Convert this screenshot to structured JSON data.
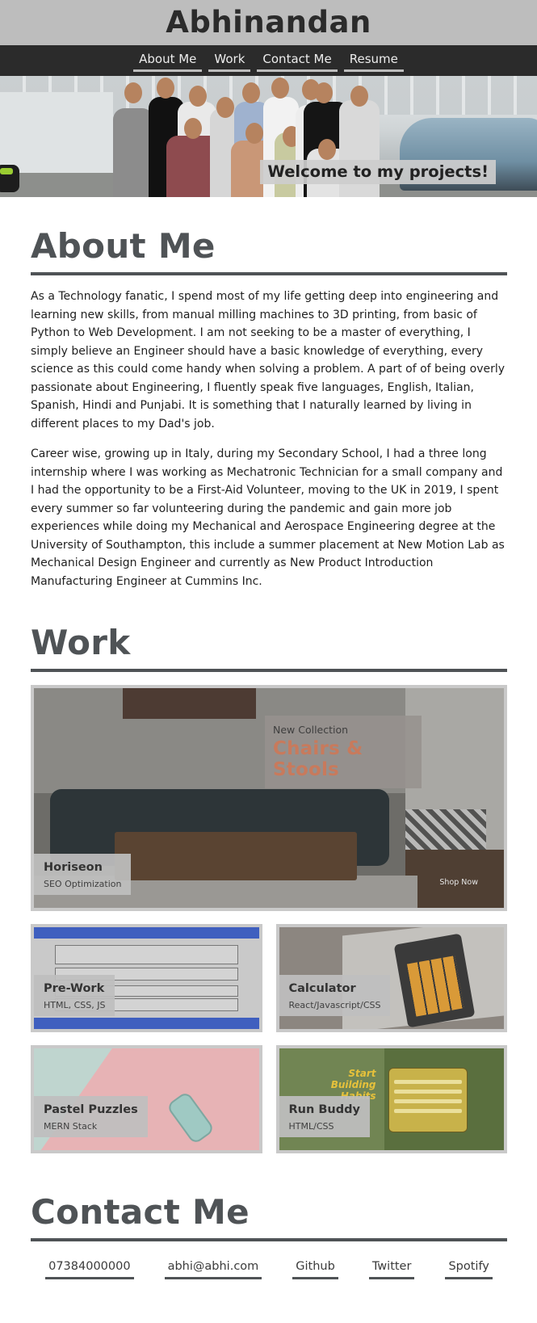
{
  "site": {
    "title": "Abhinandan"
  },
  "nav": {
    "items": [
      {
        "label": "About Me"
      },
      {
        "label": "Work"
      },
      {
        "label": "Contact Me"
      },
      {
        "label": "Resume"
      }
    ]
  },
  "hero": {
    "welcome": "Welcome to my projects!"
  },
  "about": {
    "heading": "About Me",
    "paragraphs": [
      "As a Technology fanatic, I spend most of my life getting deep into engineering and learning new skills, from manual milling machines to 3D printing, from basic of Python to Web Development. I am not seeking to be a master of everything, I simply believe an Engineer should have a basic knowledge of everything, every science as this could come handy when solving a problem. A part of of being overly passionate about Engineering, I fluently speak five languages, English, Italian, Spanish, Hindi and Punjabi. It is something that I naturally learned by living in different places to my Dad's job.",
      "Career wise, growing up in Italy, during my Secondary School, I had a three long internship where I was working as Mechatronic Technician for a small company and I had the opportunity to be a First-Aid Volunteer, moving to the UK in 2019, I spent every summer so far volunteering during the pandemic and gain more job experiences while doing my Mechanical and Aerospace Engineering degree at the University of Southampton, this include a summer placement at New Motion Lab as Mechanical Design Engineer and currently as New Product Introduction Manufacturing Engineer at Cummins Inc."
    ]
  },
  "work": {
    "heading": "Work",
    "projects": [
      {
        "title": "Horiseon",
        "subtitle": "SEO Optimization",
        "preview": {
          "collection": "New Collection",
          "headline": "Chairs & Stools",
          "cta": "Shop Now"
        }
      },
      {
        "title": "Pre-Work",
        "subtitle": "HTML, CSS, JS"
      },
      {
        "title": "Calculator",
        "subtitle": "React/Javascript/CSS"
      },
      {
        "title": "Pastel Puzzles",
        "subtitle": "MERN Stack"
      },
      {
        "title": "Run Buddy",
        "subtitle": "HTML/CSS",
        "preview": {
          "headline": "Start Building Habits"
        }
      }
    ]
  },
  "contact": {
    "heading": "Contact Me",
    "links": [
      {
        "label": "07384000000"
      },
      {
        "label": "abhi@abhi.com"
      },
      {
        "label": "Github"
      },
      {
        "label": "Twitter"
      },
      {
        "label": "Spotify"
      }
    ]
  },
  "colors": {
    "header_bg": "#bdbdbd",
    "nav_bg": "#2b2b2b",
    "heading": "#4f5356",
    "accent_headline": "#c87a5c"
  }
}
